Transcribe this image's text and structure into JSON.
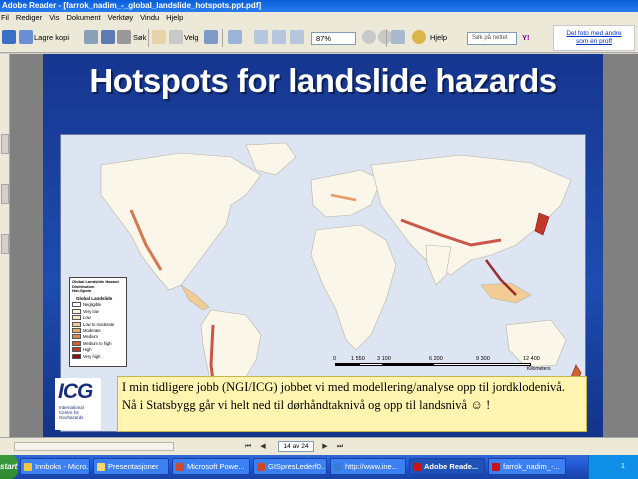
{
  "window": {
    "title": "Adobe Reader - [farrok_nadim_-_global_landslide_hotspots.ppt.pdf]"
  },
  "menu": [
    "Fil",
    "Rediger",
    "Vis",
    "Dokument",
    "Verktøy",
    "Vindu",
    "Hjelp"
  ],
  "toolbar": {
    "save_copy": "Lagre kopi",
    "search": "Søk",
    "select": "Velg",
    "zoom_value": "87%",
    "help": "Hjelp",
    "search_web_placeholder": "Søk på nettet",
    "search_web_btn": "Y!",
    "ad_text_line1": "Del foto med andre",
    "ad_text_line2": "som en proff"
  },
  "slide": {
    "title": "Hotspots for landslide hazards",
    "legend": {
      "title_lines": [
        "Global Landslide Hazard Distribution",
        "Hot-Spots"
      ],
      "subtitle": "Global Landslide",
      "items": [
        {
          "label": "Negligible",
          "color": "#ffffff"
        },
        {
          "label": "Very low",
          "color": "#fbf3e0"
        },
        {
          "label": "Low",
          "color": "#f7e4c0"
        },
        {
          "label": "Low to moderate",
          "color": "#f2cc94"
        },
        {
          "label": "Moderate",
          "color": "#e9a967"
        },
        {
          "label": "Medium",
          "color": "#df8a4a"
        },
        {
          "label": "Medium to high",
          "color": "#cf6233"
        },
        {
          "label": "High",
          "color": "#c0392b"
        },
        {
          "label": "Very high",
          "color": "#8b0f12"
        }
      ]
    },
    "scale": {
      "labels": [
        "0",
        "1 550",
        "3 100",
        "6 200",
        "9 300",
        "12 400"
      ],
      "unit": "Kilometers"
    },
    "logo": {
      "text": "ICG",
      "sub_lines": [
        "International",
        "Centre for",
        "Geohazards"
      ]
    },
    "caption": "I min tidligere jobb (NGI/ICG) jobbet vi med modellering/analyse opp til jordklodenivå.  Nå i Statsbygg går vi helt ned til dørhåndtaknivå og opp til landsnivå ☺ !"
  },
  "nav": {
    "page_indicator": "14 av 24"
  },
  "taskbar": {
    "start": "start",
    "tasks": [
      {
        "label": "Innboks - Micro...",
        "icon_color": "#f5c542"
      },
      {
        "label": "Presentasjoner",
        "icon_color": "#f5d76e"
      },
      {
        "label": "Microsoft Powe...",
        "icon_color": "#d24726"
      },
      {
        "label": "GISpresLederf0...",
        "icon_color": "#d24726"
      },
      {
        "label": "http://www.ine...",
        "icon_color": "#3a7bd5"
      },
      {
        "label": "Adobe Reade...",
        "icon_color": "#cc1111",
        "active": true
      },
      {
        "label": "farrok_nadim_-...",
        "icon_color": "#cc1111"
      }
    ],
    "tray_text": "1"
  }
}
